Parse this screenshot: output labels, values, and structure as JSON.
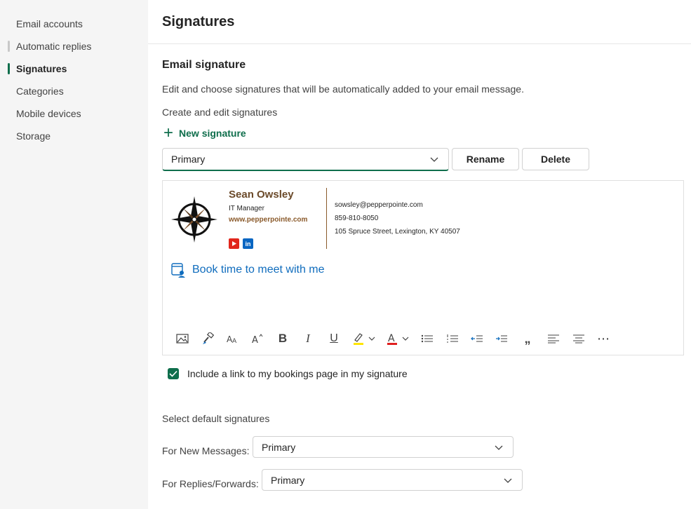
{
  "sidebar": {
    "items": [
      {
        "label": "Email accounts"
      },
      {
        "label": "Automatic replies"
      },
      {
        "label": "Signatures"
      },
      {
        "label": "Categories"
      },
      {
        "label": "Mobile devices"
      },
      {
        "label": "Storage"
      }
    ],
    "active_index": 2
  },
  "page": {
    "title": "Signatures",
    "section_title": "Email signature",
    "description": "Edit and choose signatures that will be automatically added to your email message.",
    "create_heading": "Create and edit signatures",
    "new_signature_label": "New signature",
    "signature_select_value": "Primary",
    "rename_label": "Rename",
    "delete_label": "Delete"
  },
  "signature": {
    "name": "Sean Owsley",
    "role": "IT Manager",
    "website": "www.pepperpointe.com",
    "email": "sowsley@pepperpointe.com",
    "phone": "859-810-8050",
    "address": "105 Spruce Street, Lexington, KY 40507",
    "social": [
      "youtube-icon",
      "linkedin-icon"
    ],
    "linkedin_text": "in",
    "booking_link": "Book time to meet with me"
  },
  "toolbar": {
    "buttons": [
      "insert-picture",
      "format-painter",
      "font-size",
      "change-font",
      "bold",
      "italic",
      "underline",
      "highlight",
      "font-color",
      "bullets",
      "numbering",
      "decrease-indent",
      "increase-indent",
      "quote",
      "align-left",
      "align-center",
      "more"
    ],
    "bold_glyph": "B",
    "italic_glyph": "I",
    "underline_glyph": "U",
    "quote_glyph": "„",
    "more_glyph": "⋯"
  },
  "include_bookings": {
    "checked": true,
    "label": "Include a link to my bookings page in my signature"
  },
  "defaults": {
    "heading": "Select default signatures",
    "new_messages_label": "For New Messages:",
    "new_messages_value": "Primary",
    "replies_label": "For Replies/Forwards:",
    "replies_value": "Primary"
  },
  "colors": {
    "accent": "#0f6e4c",
    "link": "#0f6cbd",
    "signature_brown": "#6b4a2a",
    "highlight_yellow": "#ffe500",
    "font_red": "#e02020"
  }
}
